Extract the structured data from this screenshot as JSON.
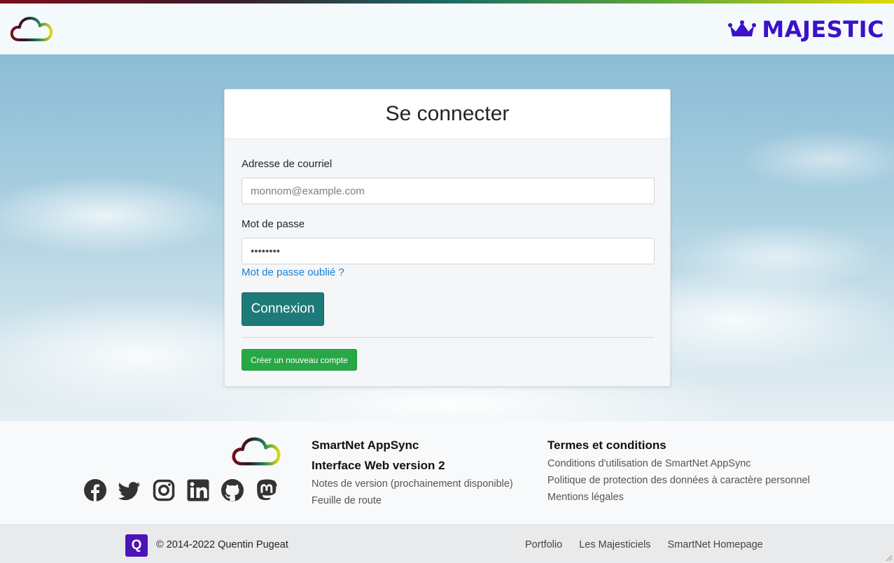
{
  "header": {
    "brand_name": "MAJESTIC",
    "brand_color": "#3b11c9",
    "logo_icon": "cloud-gradient-icon",
    "crown_icon": "crown-icon"
  },
  "login": {
    "title": "Se connecter",
    "email_label": "Adresse de courriel",
    "email_placeholder": "monnom@example.com",
    "password_label": "Mot de passe",
    "password_value": "••••••••",
    "forgot_password": "Mot de passe oublié ?",
    "login_button": "Connexion",
    "create_account_button": "Créer un nouveau compte"
  },
  "footer": {
    "social_icons": [
      "facebook-icon",
      "twitter-icon",
      "instagram-icon",
      "linkedin-icon",
      "github-icon",
      "mastodon-icon"
    ],
    "product": {
      "title": "SmartNet AppSync",
      "subtitle": "Interface Web version 2",
      "links": [
        "Notes de version (prochainement disponible)",
        "Feuille de route"
      ]
    },
    "terms": {
      "title": "Termes et conditions",
      "links": [
        "Conditions d'utilisation de SmartNet AppSync",
        "Politique de protection des données à caractère personnel",
        "Mentions légales"
      ]
    }
  },
  "bottom": {
    "badge": "Q",
    "copyright": "© 2014-2022 Quentin Pugeat",
    "links": [
      "Portfolio",
      "Les Majesticiels",
      "SmartNet Homepage"
    ]
  },
  "colors": {
    "primary_button": "#1d7a78",
    "success_button": "#28a745",
    "link": "#1a7fd0",
    "badge": "#4b13b8"
  }
}
